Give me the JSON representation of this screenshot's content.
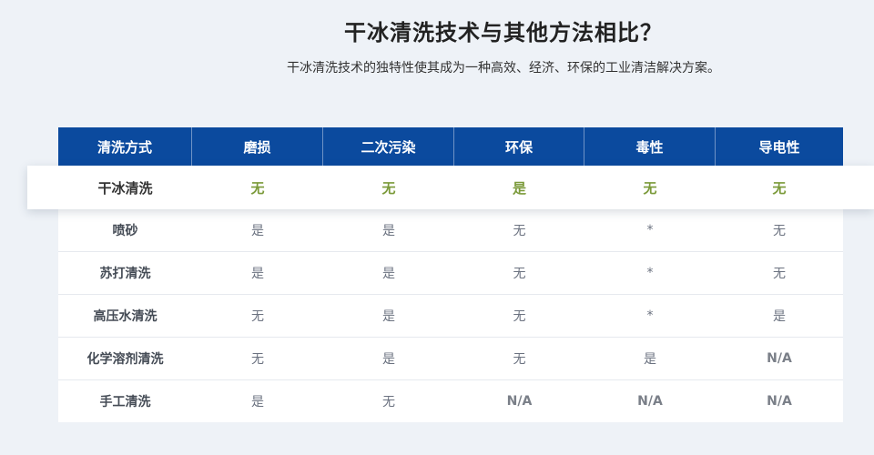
{
  "heading": {
    "title": "干冰清洗技术与其他方法相比？",
    "subtitle": "干冰清洗技术的独特性使其成为一种高效、经济、环保的工业清洁解决方案。"
  },
  "table": {
    "headers": [
      "清洗方式",
      "磨损",
      "二次污染",
      "环保",
      "毒性",
      "导电性"
    ],
    "featured": {
      "label": "干冰清洗",
      "values": [
        "无",
        "无",
        "是",
        "无",
        "无"
      ]
    },
    "rows": [
      {
        "label": "喷砂",
        "values": [
          "是",
          "是",
          "无",
          "*",
          "无"
        ]
      },
      {
        "label": "苏打清洗",
        "values": [
          "是",
          "是",
          "无",
          "*",
          "无"
        ]
      },
      {
        "label": "高压水清洗",
        "values": [
          "无",
          "是",
          "无",
          "*",
          "是"
        ]
      },
      {
        "label": "化学溶剂清洗",
        "values": [
          "无",
          "是",
          "无",
          "是",
          "N/A"
        ]
      },
      {
        "label": "手工清洗",
        "values": [
          "是",
          "无",
          "N/A",
          "N/A",
          "N/A"
        ]
      }
    ]
  },
  "colors": {
    "header_bg": "#0b4a9e",
    "featured_value": "#7b9a3a",
    "page_bg": "#eef2f7"
  }
}
